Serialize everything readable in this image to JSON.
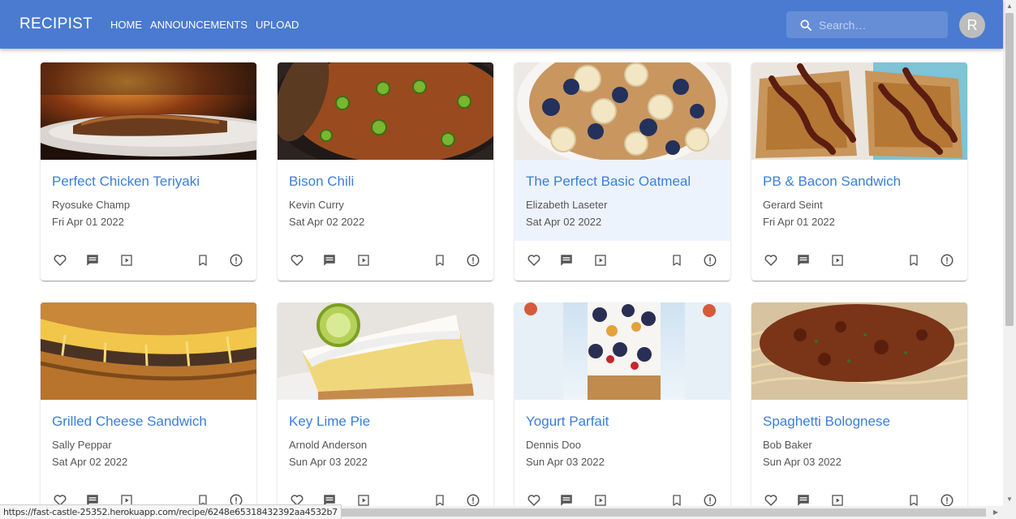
{
  "header": {
    "brand": "RECIPIST",
    "nav": [
      "HOME",
      "ANNOUNCEMENTS",
      "UPLOAD"
    ],
    "search_placeholder": "Search…",
    "avatar_initial": "R",
    "color": "#4a7bd0"
  },
  "cards": [
    {
      "title": "Perfect Chicken Teriyaki",
      "author": "Ryosuke Champ",
      "date": "Fri Apr 01 2022",
      "image": "grilled-chicken-teriyaki-photo"
    },
    {
      "title": "Bison Chili",
      "author": "Kevin Curry",
      "date": "Sat Apr 02 2022",
      "image": "bison-chili-pot-photo"
    },
    {
      "title": "The Perfect Basic Oatmeal",
      "author": "Elizabeth Laseter",
      "date": "Sat Apr 02 2022",
      "image": "oatmeal-bowl-photo"
    },
    {
      "title": "PB & Bacon Sandwich",
      "author": "Gerard Seint",
      "date": "Fri Apr 01 2022",
      "image": "bacon-toast-photo"
    },
    {
      "title": "Grilled Cheese Sandwich",
      "author": "Sally Peppar",
      "date": "Sat Apr 02 2022",
      "image": "grilled-cheese-photo"
    },
    {
      "title": "Key Lime Pie",
      "author": "Arnold Anderson",
      "date": "Sun Apr 03 2022",
      "image": "key-lime-pie-photo"
    },
    {
      "title": "Yogurt Parfait",
      "author": "Dennis Doo",
      "date": "Sun Apr 03 2022",
      "image": "yogurt-parfait-photo"
    },
    {
      "title": "Spaghetti Bolognese",
      "author": "Bob Baker",
      "date": "Sun Apr 03 2022",
      "image": "spaghetti-bolognese-photo"
    }
  ],
  "card_actions": [
    "heart-icon",
    "comment-icon",
    "video-icon",
    "bookmark-icon",
    "report-icon"
  ],
  "status_url": "https://fast-castle-25352.herokuapp.com/recipe/6248e65318432392aa4532b7",
  "colors": {
    "title": "#3d7ed9",
    "hover_bg": "#edf3fd"
  }
}
